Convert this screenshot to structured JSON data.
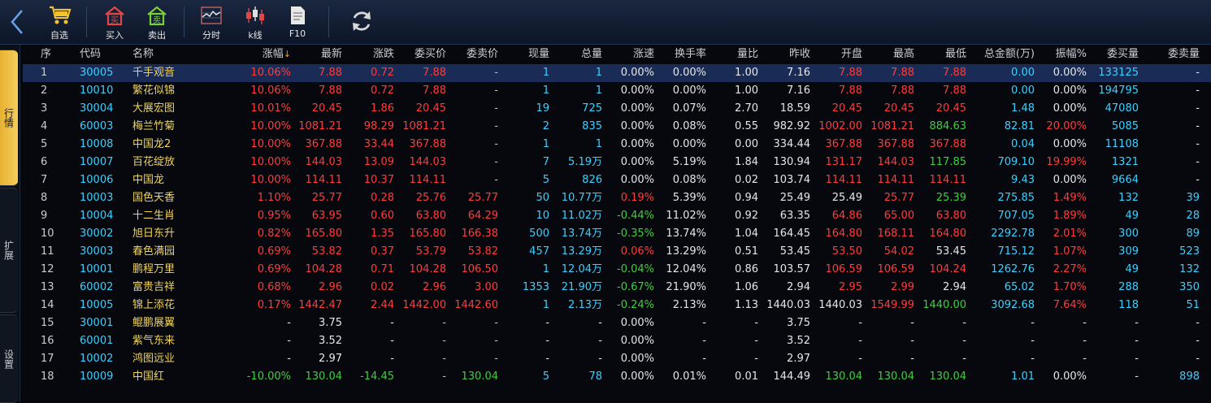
{
  "toolbar": {
    "buttons": [
      {
        "label": "自选",
        "icon": "cart-icon"
      },
      {
        "label": "买入",
        "icon": "buy-house-icon"
      },
      {
        "label": "卖出",
        "icon": "sell-house-icon"
      },
      {
        "label": "分时",
        "icon": "timeshare-chart-icon"
      },
      {
        "label": "k线",
        "icon": "candlestick-icon"
      },
      {
        "label": "F10",
        "icon": "document-icon"
      }
    ],
    "refresh_icon": "refresh-icon",
    "back_icon": "chevron-left-icon"
  },
  "side_tabs": [
    {
      "label": "行情",
      "active": true
    },
    {
      "label": "扩展",
      "active": false
    },
    {
      "label": "设置",
      "active": false
    }
  ],
  "columns": [
    "序",
    "代码",
    "名称",
    "涨幅",
    "最新",
    "涨跌",
    "委买价",
    "委卖价",
    "现量",
    "总量",
    "涨速",
    "换手率",
    "量比",
    "昨收",
    "开盘",
    "最高",
    "最低",
    "总金额(万)",
    "振幅%",
    "委买量",
    "委卖量"
  ],
  "sort_indicator": "↓",
  "rows": [
    [
      "1",
      "30005",
      "千手观音",
      "10.06%",
      "7.88",
      "0.72",
      "7.88",
      "-",
      "1",
      "1",
      "0.00%",
      "0.00%",
      "1.00",
      "7.16",
      "7.88",
      "7.88",
      "7.88",
      "0.00",
      "0.00%",
      "133125",
      "-"
    ],
    [
      "2",
      "10010",
      "繁花似锦",
      "10.06%",
      "7.88",
      "0.72",
      "7.88",
      "-",
      "1",
      "1",
      "0.00%",
      "0.00%",
      "1.00",
      "7.16",
      "7.88",
      "7.88",
      "7.88",
      "0.00",
      "0.00%",
      "194795",
      "-"
    ],
    [
      "3",
      "30004",
      "大展宏图",
      "10.01%",
      "20.45",
      "1.86",
      "20.45",
      "-",
      "19",
      "725",
      "0.00%",
      "0.07%",
      "2.70",
      "18.59",
      "20.45",
      "20.45",
      "20.45",
      "1.48",
      "0.00%",
      "47080",
      "-"
    ],
    [
      "4",
      "60003",
      "梅兰竹菊",
      "10.00%",
      "1081.21",
      "98.29",
      "1081.21",
      "-",
      "2",
      "835",
      "0.00%",
      "0.08%",
      "0.55",
      "982.92",
      "1002.00",
      "1081.21",
      "884.63",
      "82.81",
      "20.00%",
      "5085",
      "-"
    ],
    [
      "5",
      "10008",
      "中国龙2",
      "10.00%",
      "367.88",
      "33.44",
      "367.88",
      "-",
      "1",
      "1",
      "0.00%",
      "0.00%",
      "0.00",
      "334.44",
      "367.88",
      "367.88",
      "367.88",
      "0.04",
      "0.00%",
      "11108",
      "-"
    ],
    [
      "6",
      "10007",
      "百花绽放",
      "10.00%",
      "144.03",
      "13.09",
      "144.03",
      "-",
      "7",
      "5.19万",
      "0.00%",
      "5.19%",
      "1.84",
      "130.94",
      "131.17",
      "144.03",
      "117.85",
      "709.10",
      "19.99%",
      "1321",
      "-"
    ],
    [
      "7",
      "10006",
      "中国龙",
      "10.00%",
      "114.11",
      "10.37",
      "114.11",
      "-",
      "5",
      "826",
      "0.00%",
      "0.08%",
      "0.02",
      "103.74",
      "114.11",
      "114.11",
      "114.11",
      "9.43",
      "0.00%",
      "9664",
      "-"
    ],
    [
      "8",
      "10003",
      "国色天香",
      "1.10%",
      "25.77",
      "0.28",
      "25.76",
      "25.77",
      "50",
      "10.77万",
      "0.19%",
      "5.39%",
      "0.94",
      "25.49",
      "25.49",
      "25.77",
      "25.39",
      "275.85",
      "1.49%",
      "132",
      "39"
    ],
    [
      "9",
      "10004",
      "十二生肖",
      "0.95%",
      "63.95",
      "0.60",
      "63.80",
      "64.29",
      "10",
      "11.02万",
      "-0.44%",
      "11.02%",
      "0.92",
      "63.35",
      "64.86",
      "65.00",
      "63.80",
      "707.05",
      "1.89%",
      "49",
      "28"
    ],
    [
      "10",
      "30002",
      "旭日东升",
      "0.82%",
      "165.80",
      "1.35",
      "165.80",
      "166.38",
      "500",
      "13.74万",
      "-0.35%",
      "13.74%",
      "1.04",
      "164.45",
      "164.80",
      "168.11",
      "164.80",
      "2292.78",
      "2.01%",
      "300",
      "89"
    ],
    [
      "11",
      "30003",
      "春色满园",
      "0.69%",
      "53.82",
      "0.37",
      "53.79",
      "53.82",
      "457",
      "13.29万",
      "0.06%",
      "13.29%",
      "0.51",
      "53.45",
      "53.50",
      "54.02",
      "53.45",
      "715.12",
      "1.07%",
      "309",
      "523"
    ],
    [
      "12",
      "10001",
      "鹏程万里",
      "0.69%",
      "104.28",
      "0.71",
      "104.28",
      "106.50",
      "1",
      "12.04万",
      "-0.04%",
      "12.04%",
      "0.86",
      "103.57",
      "106.59",
      "106.59",
      "104.24",
      "1262.76",
      "2.27%",
      "49",
      "132"
    ],
    [
      "13",
      "60002",
      "富贵吉祥",
      "0.68%",
      "2.96",
      "0.02",
      "2.96",
      "3.00",
      "1353",
      "21.90万",
      "-0.67%",
      "21.90%",
      "1.06",
      "2.94",
      "2.95",
      "2.99",
      "2.94",
      "65.02",
      "1.70%",
      "288",
      "350"
    ],
    [
      "14",
      "10005",
      "锦上添花",
      "0.17%",
      "1442.47",
      "2.44",
      "1442.00",
      "1442.60",
      "1",
      "2.13万",
      "-0.24%",
      "2.13%",
      "1.13",
      "1440.03",
      "1440.03",
      "1549.99",
      "1440.00",
      "3092.68",
      "7.64%",
      "118",
      "51"
    ],
    [
      "15",
      "30001",
      "鲲鹏展翼",
      "-",
      "3.75",
      "-",
      "-",
      "-",
      "-",
      "-",
      "0.00%",
      "-",
      "-",
      "3.75",
      "-",
      "-",
      "-",
      "-",
      "-",
      "-",
      "-"
    ],
    [
      "16",
      "60001",
      "紫气东来",
      "-",
      "3.52",
      "-",
      "-",
      "-",
      "-",
      "-",
      "0.00%",
      "-",
      "-",
      "3.52",
      "-",
      "-",
      "-",
      "-",
      "-",
      "-",
      "-"
    ],
    [
      "17",
      "10002",
      "鸿图远业",
      "-",
      "2.97",
      "-",
      "-",
      "-",
      "-",
      "-",
      "0.00%",
      "-",
      "-",
      "2.97",
      "-",
      "-",
      "-",
      "-",
      "-",
      "-",
      "-"
    ],
    [
      "18",
      "10009",
      "中国红",
      "-10.00%",
      "130.04",
      "-14.45",
      "-",
      "130.04",
      "5",
      "78",
      "0.00%",
      "0.01%",
      "0.01",
      "144.49",
      "130.04",
      "130.04",
      "130.04",
      "1.01",
      "0.00%",
      "-",
      "898"
    ]
  ],
  "colors": {
    "up": "#ff3c3c",
    "down": "#3ecf3e",
    "flat": "#e6e6e6",
    "code": "#3ad0ff",
    "name": "#f0d35a",
    "selected_row": "#1a2c55"
  }
}
